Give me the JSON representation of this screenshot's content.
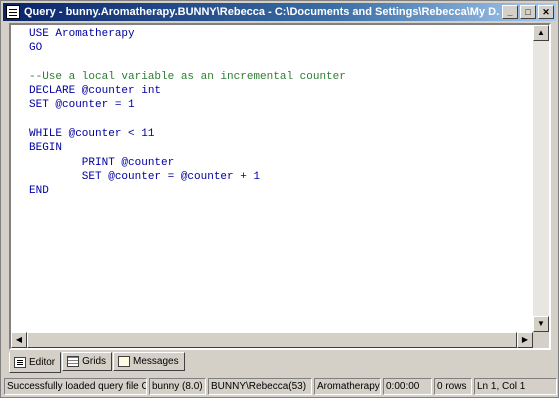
{
  "window": {
    "title": "Query - bunny.Aromatherapy.BUNNY\\Rebecca - C:\\Documents and Settings\\Rebecca\\My D...",
    "buttons": {
      "minimize": "_",
      "maximize": "□",
      "close": "✕"
    }
  },
  "editor": {
    "lines": [
      {
        "text": "USE Aromatherapy",
        "style": "blue"
      },
      {
        "text": "GO",
        "style": "blue"
      },
      {
        "text": "",
        "style": "plain"
      },
      {
        "text": "--Use a local variable as an incremental counter",
        "style": "comment"
      },
      {
        "text": "DECLARE @counter int",
        "style": "blue"
      },
      {
        "text": "SET @counter = 1",
        "style": "blue"
      },
      {
        "text": "",
        "style": "plain"
      },
      {
        "text": "WHILE @counter < 11",
        "style": "blue"
      },
      {
        "text": "BEGIN",
        "style": "blue"
      },
      {
        "text": "        PRINT @counter",
        "style": "blue"
      },
      {
        "text": "        SET @counter = @counter + 1",
        "style": "blue"
      },
      {
        "text": "END",
        "style": "blue"
      }
    ]
  },
  "tabs": [
    {
      "label": "Editor",
      "icon": "editor-icon",
      "active": true
    },
    {
      "label": "Grids",
      "icon": "grid-icon",
      "active": false
    },
    {
      "label": "Messages",
      "icon": "messages-icon",
      "active": false
    }
  ],
  "statusbar": {
    "message": "Successfully loaded query file C:\\",
    "server": "bunny (8.0)",
    "user": "BUNNY\\Rebecca(53)",
    "database": "Aromatherapy",
    "time": "0:00:00",
    "rows": "0 rows",
    "position": "Ln 1, Col 1"
  }
}
